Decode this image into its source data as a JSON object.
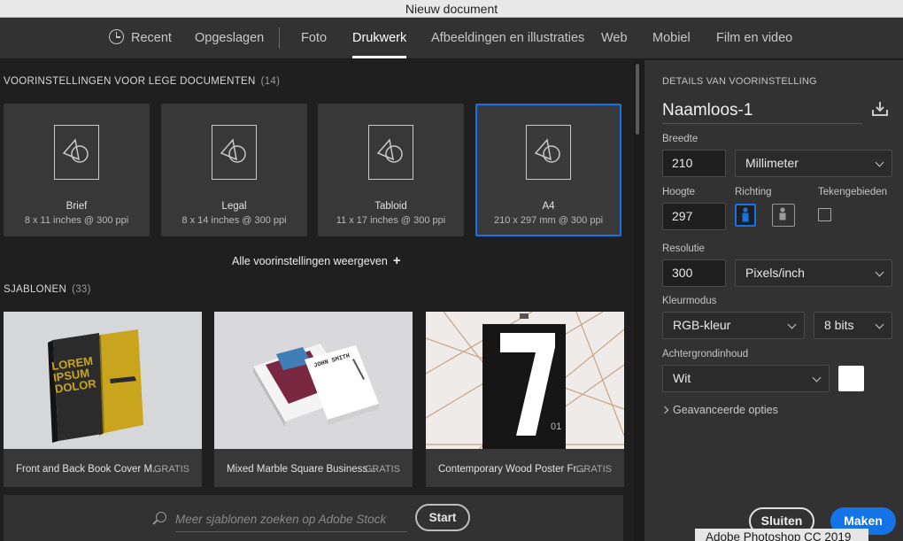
{
  "window": {
    "title": "Nieuw document"
  },
  "tabs": [
    {
      "label": "Recent"
    },
    {
      "label": "Opgeslagen"
    },
    {
      "label": "Foto"
    },
    {
      "label": "Drukwerk"
    },
    {
      "label": "Afbeeldingen en illustraties"
    },
    {
      "label": "Web"
    },
    {
      "label": "Mobiel"
    },
    {
      "label": "Film en video"
    }
  ],
  "presets_section": {
    "title": "VOORINSTELLINGEN VOOR LEGE DOCUMENTEN",
    "count": "(14)"
  },
  "presets": [
    {
      "name": "Brief",
      "size": "8 x 11 inches @ 300 ppi"
    },
    {
      "name": "Legal",
      "size": "8 x 14 inches @ 300 ppi"
    },
    {
      "name": "Tabloid",
      "size": "11 x 17 inches @ 300 ppi"
    },
    {
      "name": "A4",
      "size": "210 x 297 mm @ 300 ppi"
    }
  ],
  "all_presets_label": "Alle voorinstellingen weergeven",
  "templates_section": {
    "title": "SJABLONEN",
    "count": "(33)"
  },
  "templates": [
    {
      "name": "Front and Back Book Cover M...",
      "badge": "GRATIS",
      "thumb_text": "LOREM IPSUM DOLOR"
    },
    {
      "name": "Mixed Marble Square Business...",
      "badge": "GRATIS",
      "thumb_text": "JOHN SMITH"
    },
    {
      "name": "Contemporary Wood Poster Fr...",
      "badge": "GRATIS",
      "thumb_text": "7",
      "thumb_small": "01"
    }
  ],
  "search": {
    "placeholder": "Meer sjablonen zoeken op Adobe Stock",
    "button": "Start"
  },
  "details": {
    "section_title": "DETAILS VAN VOORINSTELLING",
    "doc_name": "Naamloos-1",
    "width_label": "Breedte",
    "width_value": "210",
    "width_unit": "Millimeter",
    "height_label": "Hoogte",
    "height_value": "297",
    "orientation_label": "Richting",
    "artboards_label": "Tekengebieden",
    "resolution_label": "Resolutie",
    "resolution_value": "300",
    "resolution_unit": "Pixels/inch",
    "color_mode_label": "Kleurmodus",
    "color_mode": "RGB-kleur",
    "bit_depth": "8 bits",
    "background_label": "Achtergrondinhoud",
    "background_value": "Wit",
    "background_color": "#ffffff",
    "advanced_label": "Geavanceerde opties"
  },
  "actions": {
    "close": "Sluiten",
    "make": "Maken"
  },
  "tooltip": "Adobe Photoshop CC 2019",
  "colors": {
    "accent": "#1473e6"
  }
}
